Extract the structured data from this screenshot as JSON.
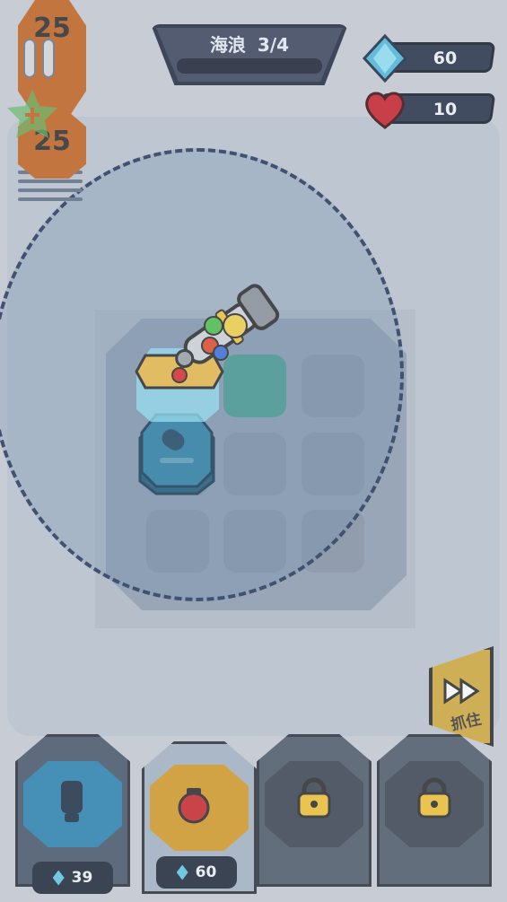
{
  "hud": {
    "wave_label": "海浪",
    "wave_progress": "3/4",
    "gems": "60",
    "health": "10"
  },
  "tower_stack": {
    "top_count": "25",
    "second_count": "25"
  },
  "fast_forward": {
    "label": "抓住"
  },
  "shop": {
    "cards": [
      {
        "name": "bomb-tower",
        "price": "39",
        "locked": false
      },
      {
        "name": "red-tower",
        "price": "60",
        "locked": false
      },
      {
        "name": "locked-slot-1",
        "locked": true
      },
      {
        "name": "locked-slot-2",
        "locked": true
      }
    ]
  },
  "colors": {
    "accent_gold": "#d1a93a",
    "gem_blue": "#5ec9e3",
    "heart_red": "#c8202a",
    "range_ring": "#24365a"
  },
  "icons": [
    "pause-icon",
    "gem-icon",
    "heart-icon",
    "fast-forward-icon",
    "lock-icon",
    "bomb-icon",
    "cannon-tower-icon"
  ]
}
